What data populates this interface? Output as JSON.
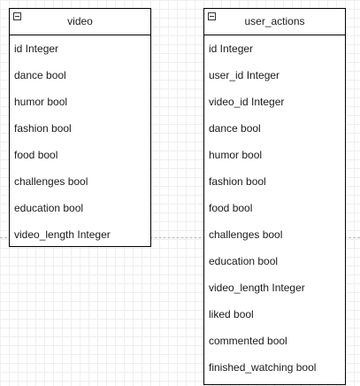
{
  "entities": [
    {
      "id": "video",
      "title": "video",
      "fields": [
        "id Integer",
        "dance bool",
        "humor bool",
        "fashion bool",
        "food bool",
        "challenges bool",
        "education bool",
        "video_length Integer"
      ]
    },
    {
      "id": "user_actions",
      "title": "user_actions",
      "fields": [
        "id Integer",
        "user_id Integer",
        "video_id Integer",
        "dance bool",
        "humor bool",
        "fashion bool",
        "food bool",
        "challenges bool",
        "education bool",
        "video_length Integer",
        "liked bool",
        "commented bool",
        "finished_watching bool"
      ]
    }
  ],
  "icons": {
    "collapse": "collapse-minus-icon"
  },
  "colors": {
    "canvas_background": "#ffffff",
    "grid_line": "#e6e6e6",
    "entity_border": "#000000",
    "text": "#1a1a1a"
  }
}
